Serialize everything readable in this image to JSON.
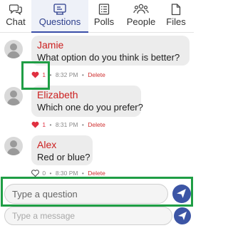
{
  "tabs": [
    {
      "label": "Chat",
      "icon": "chat-bubbles-icon",
      "active": false
    },
    {
      "label": "Questions",
      "icon": "questions-board-icon",
      "active": true
    },
    {
      "label": "Polls",
      "icon": "poll-list-icon",
      "active": false
    },
    {
      "label": "People",
      "icon": "people-group-icon",
      "active": false
    },
    {
      "label": "Files",
      "icon": "file-icon",
      "active": false
    }
  ],
  "messages": [
    {
      "author": "Jamie",
      "text": "What option do you think is better?",
      "likes": "1",
      "liked": true,
      "time": "8:32 PM",
      "delete_label": "Delete"
    },
    {
      "author": "Elizabeth",
      "text": "Which one do you prefer?",
      "likes": "1",
      "liked": true,
      "time": "8:31 PM",
      "delete_label": "Delete"
    },
    {
      "author": "Alex",
      "text": "Red or blue?",
      "likes": "0",
      "liked": false,
      "time": "8:30 PM",
      "delete_label": "Delete"
    }
  ],
  "meta_separator": "•",
  "question_input": {
    "placeholder": "Type a question"
  },
  "message_input": {
    "placeholder": "Type a message"
  },
  "colors": {
    "accent": "#3c55a5",
    "author": "#cc2020",
    "highlight": "#1f9e45",
    "heart": "#e03040"
  }
}
